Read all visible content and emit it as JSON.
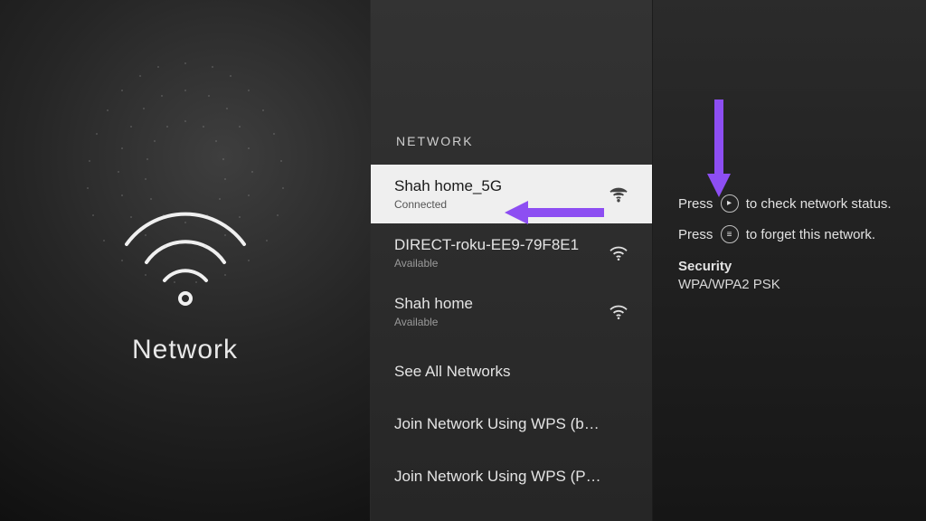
{
  "left": {
    "title": "Network"
  },
  "center": {
    "header": "NETWORK",
    "items": [
      {
        "name": "Shah home_5G",
        "status": "Connected",
        "selected": true,
        "hasSignal": true
      },
      {
        "name": "DIRECT-roku-EE9-79F8E1",
        "status": "Available",
        "selected": false,
        "hasSignal": true
      },
      {
        "name": "Shah home",
        "status": "Available",
        "selected": false,
        "hasSignal": true
      },
      {
        "name": "See All Networks",
        "status": "",
        "selected": false,
        "hasSignal": false
      },
      {
        "name": "Join Network Using WPS (button)",
        "status": "",
        "selected": false,
        "hasSignal": false
      },
      {
        "name": "Join Network Using WPS (PIN)",
        "status": "",
        "selected": false,
        "hasSignal": false
      }
    ]
  },
  "right": {
    "hint1_pre": "Press",
    "hint1_post": "to check network status.",
    "hint2_pre": "Press",
    "hint2_post": "to forget this network.",
    "security_label": "Security",
    "security_value": "WPA/WPA2 PSK",
    "play_glyph": "▸",
    "menu_glyph": "≡"
  },
  "colors": {
    "accent_arrow": "#8d4ef2"
  }
}
